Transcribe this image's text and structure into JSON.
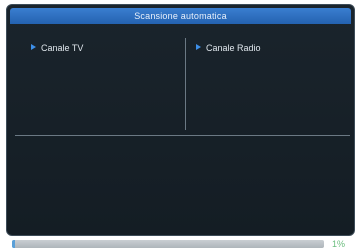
{
  "dialog": {
    "title": "Scansione automatica",
    "columns": {
      "tv_label": "Canale TV",
      "radio_label": "Canale Radio"
    }
  },
  "progress": {
    "text": "1%",
    "fraction": 0.01
  },
  "colors": {
    "title_bar": "#2f6fc0",
    "arrow": "#3d8fe8",
    "panel_bg": "#172129",
    "progress_text": "#6bbd7e"
  },
  "icons": {
    "column_marker": "triangle-right-icon"
  }
}
